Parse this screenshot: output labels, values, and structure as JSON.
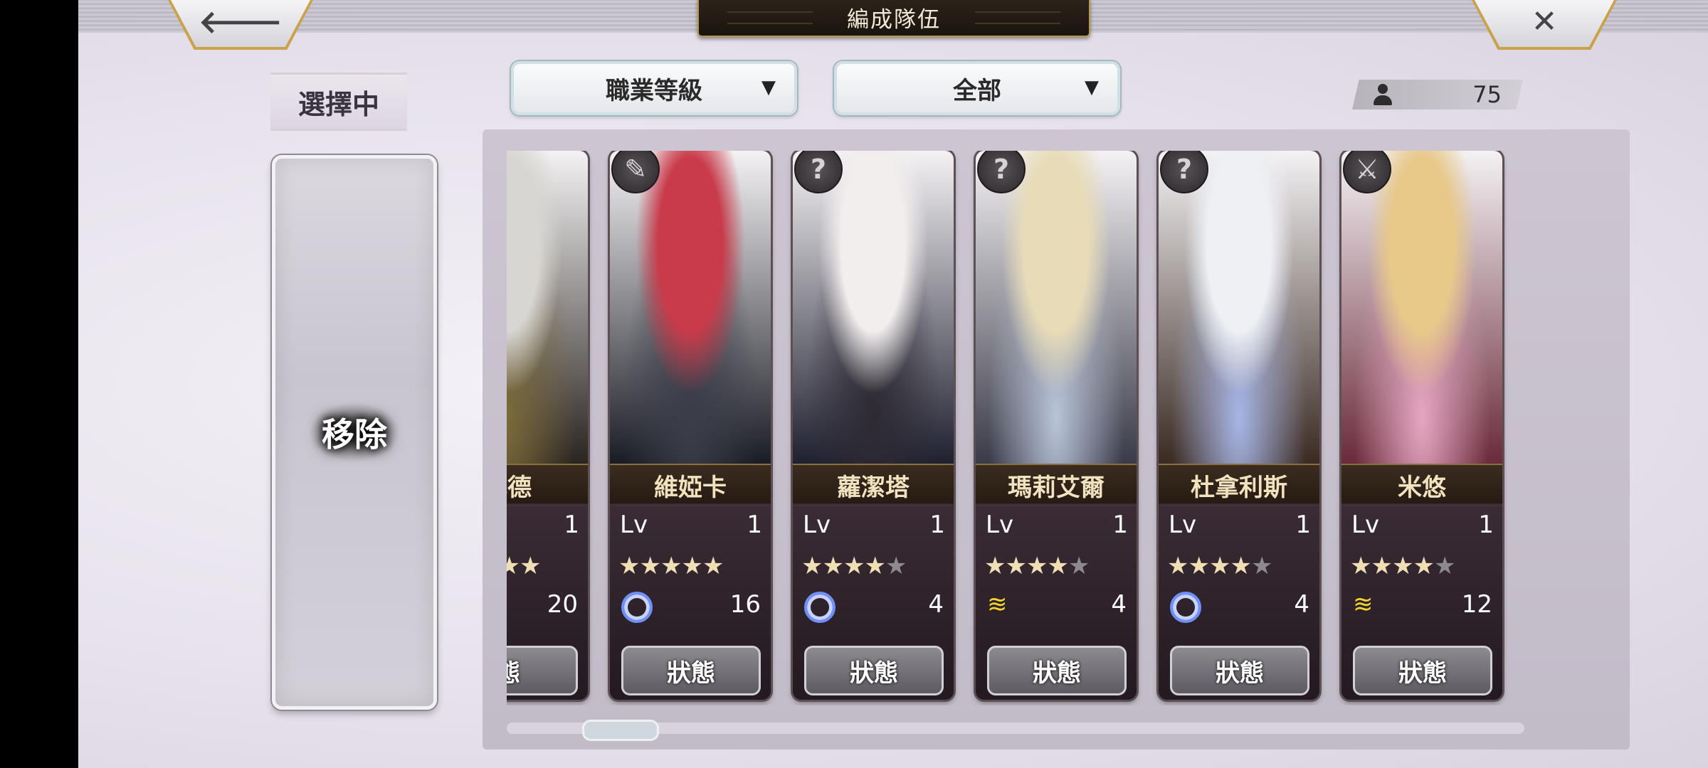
{
  "header": {
    "title": "編成隊伍",
    "back_glyph": "🡐",
    "close_glyph": "✕"
  },
  "selection": {
    "label": "選擇中",
    "remove_label": "移除"
  },
  "filters": {
    "sort": {
      "label": "職業等級",
      "arrow": "▼"
    },
    "category": {
      "label": "全部",
      "arrow": "▼"
    }
  },
  "count": {
    "value": "75"
  },
  "cards": [
    {
      "name": "基德",
      "lv_label": "Lv",
      "level": "1",
      "stars_on": 5,
      "element": "none",
      "value": "20",
      "status_label": "態",
      "badge": "",
      "palette": [
        "#d8d6d2",
        "#7a6a3a",
        "#2a2420"
      ]
    },
    {
      "name": "維婭卡",
      "lv_label": "Lv",
      "level": "1",
      "stars_on": 5,
      "element": "water",
      "value": "16",
      "status_label": "狀態",
      "badge": "✎",
      "palette": [
        "#c93a4a",
        "#3b3d4a",
        "#1a1c24"
      ]
    },
    {
      "name": "蘿潔塔",
      "lv_label": "Lv",
      "level": "1",
      "stars_on": 4,
      "element": "water",
      "value": "4",
      "status_label": "狀態",
      "badge": "?",
      "palette": [
        "#f2eeee",
        "#2d2a32",
        "#1f2030"
      ]
    },
    {
      "name": "瑪莉艾爾",
      "lv_label": "Lv",
      "level": "1",
      "stars_on": 4,
      "element": "wind",
      "value": "4",
      "status_label": "狀態",
      "badge": "?",
      "palette": [
        "#e8dcb8",
        "#b8c4d8",
        "#3a3a48"
      ]
    },
    {
      "name": "杜拿利斯",
      "lv_label": "Lv",
      "level": "1",
      "stars_on": 4,
      "element": "water",
      "value": "4",
      "status_label": "狀態",
      "badge": "?",
      "palette": [
        "#eef0f4",
        "#a8b6e6",
        "#3a2a22"
      ]
    },
    {
      "name": "米悠",
      "lv_label": "Lv",
      "level": "1",
      "stars_on": 4,
      "element": "wind",
      "value": "12",
      "status_label": "狀態",
      "badge": "⚔",
      "palette": [
        "#e8c98a",
        "#e6a6c2",
        "#6a2a3a"
      ]
    }
  ],
  "icons": {
    "person": "person-icon",
    "water": "water-element-icon",
    "wind": "wind-element-icon"
  },
  "colors": {
    "gold": "#c9a24c",
    "star_on": "#f0dfb4",
    "star_off": "#8d8a8f"
  }
}
